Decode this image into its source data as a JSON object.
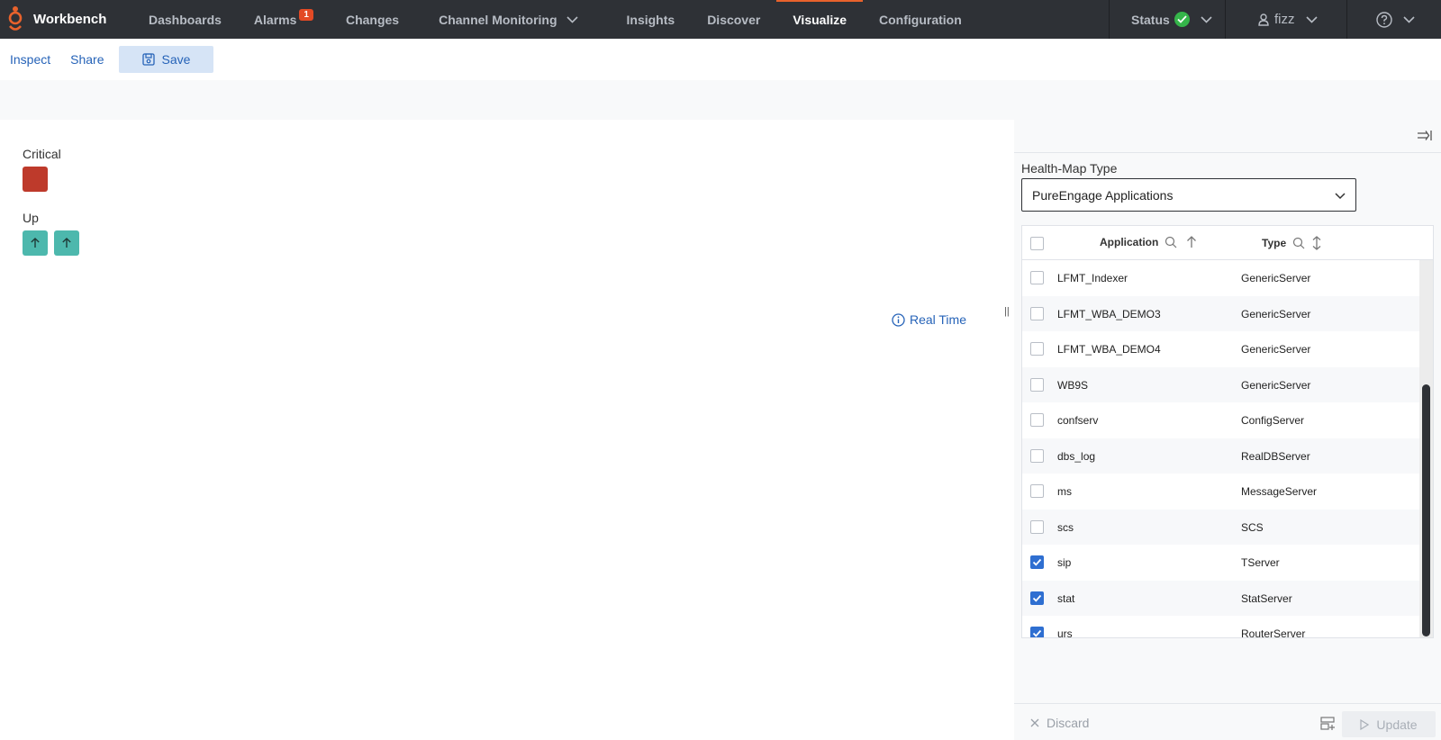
{
  "app": {
    "name": "Workbench"
  },
  "nav": {
    "items": [
      {
        "id": "dashboards",
        "label": "Dashboards"
      },
      {
        "id": "alarms",
        "label": "Alarms",
        "badge": "1"
      },
      {
        "id": "changes",
        "label": "Changes"
      },
      {
        "id": "channel-monitoring",
        "label": "Channel Monitoring"
      },
      {
        "id": "insights",
        "label": "Insights"
      },
      {
        "id": "discover",
        "label": "Discover"
      },
      {
        "id": "visualize",
        "label": "Visualize"
      },
      {
        "id": "configuration",
        "label": "Configuration"
      }
    ],
    "status_label": "Status",
    "user_label": "fizz"
  },
  "toolbar": {
    "inspect": "Inspect",
    "share": "Share",
    "save": "Save"
  },
  "map": {
    "groups": [
      {
        "label": "Critical",
        "tiles": 1
      },
      {
        "label": "Up",
        "tiles": 2
      }
    ],
    "realtime_label": "Real Time"
  },
  "panel": {
    "hm_type_label": "Health-Map Type",
    "hm_type_value": "PureEngage Applications",
    "columns": {
      "application": "Application",
      "type": "Type"
    },
    "rows": [
      {
        "app": "LFMT_Indexer",
        "type": "GenericServer",
        "checked": false
      },
      {
        "app": "LFMT_WBA_DEMO3",
        "type": "GenericServer",
        "checked": false
      },
      {
        "app": "LFMT_WBA_DEMO4",
        "type": "GenericServer",
        "checked": false
      },
      {
        "app": "WB9S",
        "type": "GenericServer",
        "checked": false
      },
      {
        "app": "confserv",
        "type": "ConfigServer",
        "checked": false
      },
      {
        "app": "dbs_log",
        "type": "RealDBServer",
        "checked": false
      },
      {
        "app": "ms",
        "type": "MessageServer",
        "checked": false
      },
      {
        "app": "scs",
        "type": "SCS",
        "checked": false
      },
      {
        "app": "sip",
        "type": "TServer",
        "checked": true
      },
      {
        "app": "stat",
        "type": "StatServer",
        "checked": true
      },
      {
        "app": "urs",
        "type": "RouterServer",
        "checked": true
      }
    ],
    "discard": "Discard",
    "update": "Update"
  },
  "colors": {
    "nav_bg": "#2e3136",
    "accent": "#e8622c",
    "link": "#2663b8",
    "critical": "#be3a2b",
    "up": "#4db8ad",
    "status_ok": "#35b54a"
  }
}
